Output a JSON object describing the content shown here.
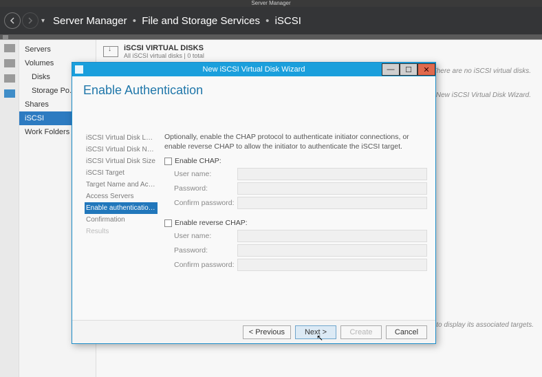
{
  "app_title": "Server Manager",
  "breadcrumb": {
    "lvl0": "Server Manager",
    "lvl1": "File and Storage Services",
    "lvl2": "iSCSI"
  },
  "side_nav": {
    "items": [
      {
        "label": "Servers"
      },
      {
        "label": "Volumes"
      },
      {
        "label": "Disks"
      },
      {
        "label": "Storage Po..."
      },
      {
        "label": "Shares"
      },
      {
        "label": "iSCSI"
      },
      {
        "label": "Work Folders"
      }
    ]
  },
  "content": {
    "vd_title": "iSCSI VIRTUAL DISKS",
    "vd_sub": "All iSCSI virtual disks | 0 total",
    "no_disks_msg": "There are no iSCSI virtual disks.",
    "hint_msg": "disk, start the New iSCSI Virtual Disk Wizard.",
    "hint2_msg": "VHD to display its associated targets."
  },
  "wizard": {
    "title": "New iSCSI Virtual Disk Wizard",
    "heading": "Enable Authentication",
    "steps": [
      "iSCSI Virtual Disk Location",
      "iSCSI Virtual Disk Name",
      "iSCSI Virtual Disk Size",
      "iSCSI Target",
      "Target Name and Access",
      "Access Servers",
      "Enable authentication ser...",
      "Confirmation",
      "Results"
    ],
    "desc": "Optionally, enable the CHAP protocol to authenticate initiator connections, or enable reverse CHAP to allow the initiator to authenticate the iSCSI target.",
    "enable_chap_label": "Enable CHAP:",
    "enable_rchap_label": "Enable reverse CHAP:",
    "fields": {
      "user": "User name:",
      "pass": "Password:",
      "cpass": "Confirm password:"
    },
    "buttons": {
      "prev": "< Previous",
      "next": "Next >",
      "create": "Create",
      "cancel": "Cancel"
    }
  }
}
